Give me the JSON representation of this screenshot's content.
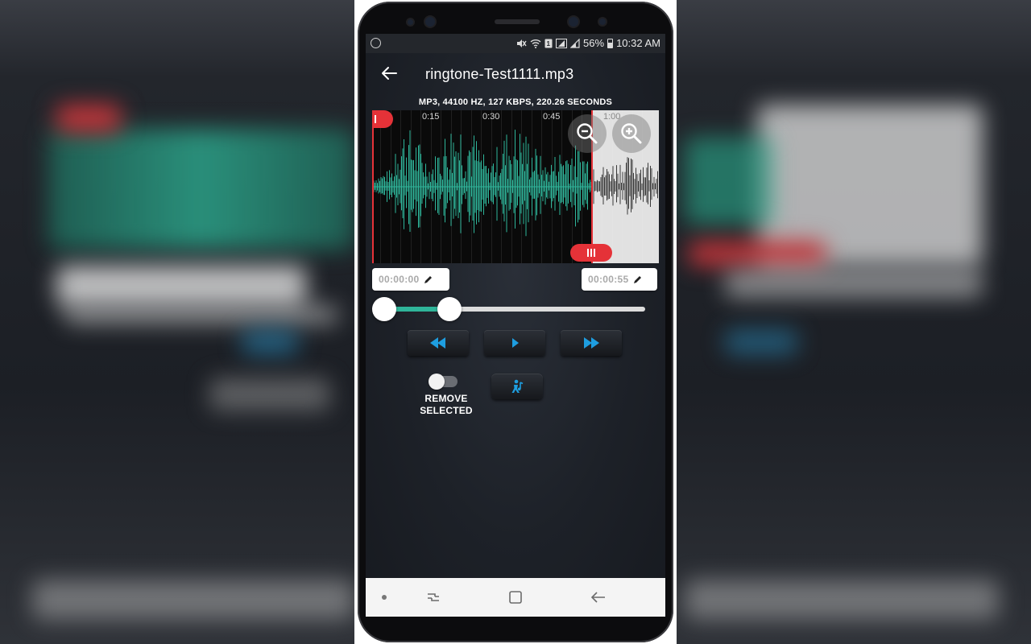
{
  "status_bar": {
    "battery": "56%",
    "time": "10:32 AM",
    "icons": [
      "mute-icon",
      "wifi-icon",
      "sim-icon",
      "signal-icon",
      "battery-icon"
    ]
  },
  "app_bar": {
    "title": "ringtone-Test1111.mp3",
    "back_icon": "arrow-left-icon"
  },
  "audio_info": "MP3, 44100 HZ, 127 KBPS, 220.26 SECONDS",
  "waveform": {
    "tick_labels": [
      "0:15",
      "0:30",
      "0:45",
      "1:00"
    ],
    "selection_color": "#2fb59a",
    "unselected_color": "#3a3a3a",
    "marker_color": "#e53238",
    "zoom_out_icon": "zoom-out-icon",
    "zoom_in_icon": "zoom-in-icon"
  },
  "selection": {
    "start_time": "00:00:00",
    "end_time": "00:00:55",
    "edit_icon": "pencil-icon"
  },
  "playback_slider": {
    "accent": "#2fb59a"
  },
  "controls": {
    "rewind_icon": "rewind-icon",
    "play_icon": "play-icon",
    "fast_forward_icon": "fast-forward-icon",
    "icon_color": "#1e9ee0"
  },
  "options": {
    "remove_selected_label_line1": "REMOVE",
    "remove_selected_label_line2": "SELECTED",
    "remove_selected_on": false,
    "ringtone_icon": "music-note-person-icon"
  },
  "nav_bar": {
    "recent_icon": "recent-apps-icon",
    "home_icon": "home-icon",
    "back_icon": "back-icon"
  }
}
